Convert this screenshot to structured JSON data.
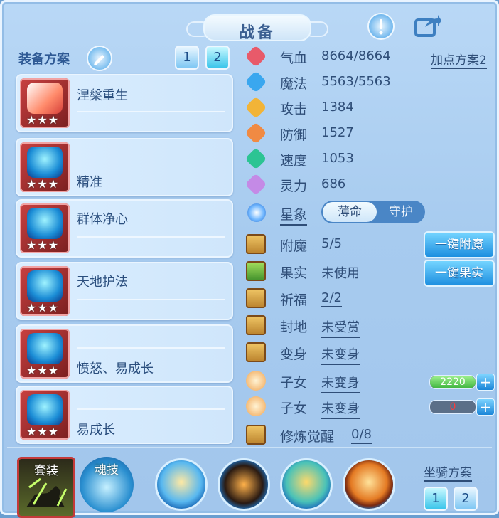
{
  "window": {
    "title": "战备"
  },
  "left": {
    "header": "装备方案",
    "tabs": [
      "1",
      "2"
    ],
    "items": [
      {
        "name": "涅槃重生",
        "stars": "★★★"
      },
      {
        "name": "精准",
        "stars": "★★★"
      },
      {
        "name": "群体净心",
        "stars": "★★★"
      },
      {
        "name": "天地护法",
        "stars": "★★★"
      },
      {
        "name": "愤怒、易成长",
        "stars": "★★★"
      },
      {
        "name": "易成长",
        "stars": "★★★"
      }
    ]
  },
  "stats": {
    "plan_link": "加点方案2",
    "rows": [
      {
        "label": "气血",
        "value": "8664/8664",
        "color": "#e85a6a"
      },
      {
        "label": "魔法",
        "value": "5563/5563",
        "color": "#3aa7ef"
      },
      {
        "label": "攻击",
        "value": "1384",
        "color": "#f2b437"
      },
      {
        "label": "防御",
        "value": "1527",
        "color": "#f08a43"
      },
      {
        "label": "速度",
        "value": "1053",
        "color": "#2cc493"
      },
      {
        "label": "灵力",
        "value": "686",
        "color": "#c48ae6"
      }
    ],
    "constellation": {
      "label": "星象",
      "option_on": "薄命",
      "option_off": "守护"
    },
    "extras": [
      {
        "label": "附魔",
        "value": "5/5",
        "green": true
      },
      {
        "label": "果实",
        "value": "未使用",
        "green": false
      },
      {
        "label": "祈福",
        "value": "2/2",
        "green": true
      },
      {
        "label": "封地",
        "value": "未受赏",
        "green": false
      },
      {
        "label": "变身",
        "value": "未变身",
        "green": false
      },
      {
        "label": "子女",
        "value": "未变身",
        "green": false
      },
      {
        "label": "子女",
        "value": "未变身",
        "green": false
      },
      {
        "label": "修炼觉醒",
        "value": "0/8",
        "green": false
      }
    ],
    "buttons": {
      "enchant_all": "一键附魔",
      "fruit_all": "一键果实"
    },
    "bars": [
      {
        "value": "2220",
        "fill": 1.0
      },
      {
        "value": "0",
        "fill": 0.0
      }
    ]
  },
  "bottom": {
    "suit_label": "套装",
    "soul_label": "魂技",
    "mount_label": "坐骑方案",
    "mount_tabs": [
      "1",
      "2"
    ]
  }
}
